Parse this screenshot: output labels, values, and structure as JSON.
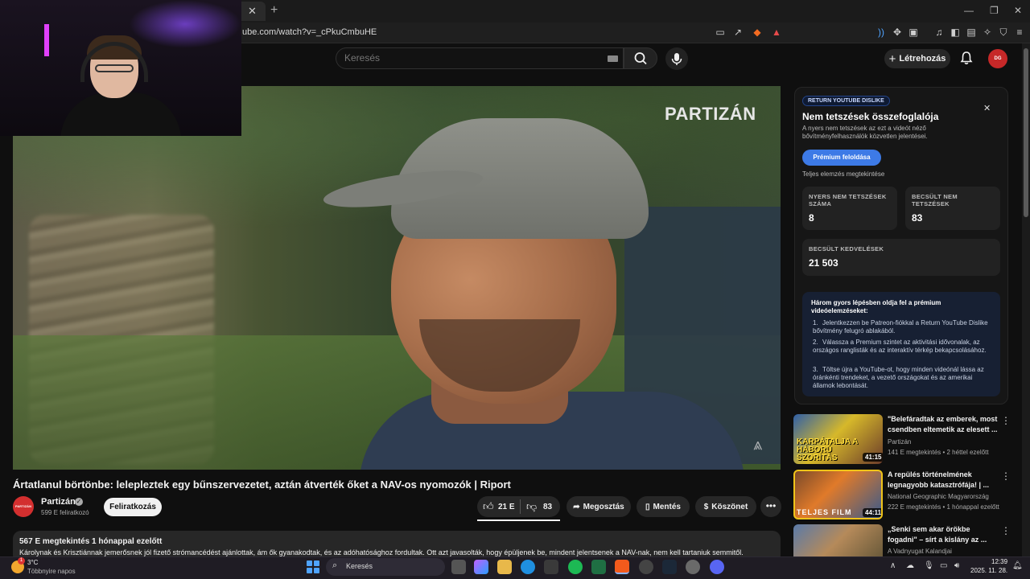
{
  "browser": {
    "url": "ube.com/watch?v=_cPkuCmbuHE"
  },
  "header": {
    "search_placeholder": "Keresés",
    "create_label": "Létrehozás",
    "avatar_text": "DG"
  },
  "video": {
    "watermark": "PARTIZÁN",
    "title": "Ártatlanul börtönbe: lelepleztek egy bűnszervezetet, aztán átverték őket a NAV-os nyomozók | Riport",
    "channel": "Partizán",
    "channel_logo_text": "PARTIZÁN",
    "subscribers": "599 E feliratkozó",
    "subscribe_label": "Feliratkozás",
    "likes": "21 E",
    "dislikes": "83",
    "share_label": "Megosztás",
    "save_label": "Mentés",
    "thanks_label": "Köszönet",
    "desc_meta": "567 E megtekintés  1 hónappal ezelőtt",
    "desc_text": "Károlynak és Krisztiánnak jemerősnek jól fizető strómancédést ajánlottak, ám ők gyanakodtak, és az adóhatósághoz fordultak. Ott azt javasolták, hogy épüljenek be, mindent jelentsenek a NAV-nak, nem kell tartaniuk semmitől."
  },
  "dislike_panel": {
    "tag": "RETURN YOUTUBE DISLIKE",
    "title": "Nem tetszések összefoglalója",
    "subtitle": "A nyers nem tetszések az ezt a videót néző bővítményfelhasználók közvetlen jelentései.",
    "premium_label": "Prémium feloldása",
    "full_analysis": "Teljes elemzés megtekintése",
    "raw_label": "NYERS NEM TETSZÉSEK SZÁMA",
    "raw_value": "8",
    "est_dislikes_label": "BECSÜLT NEM TETSZÉSEK",
    "est_dislikes_value": "83",
    "est_likes_label": "BECSÜLT KEDVELÉSEK",
    "est_likes_value": "21 503",
    "steps_title": "Három gyors lépésben oldja fel a prémium videóelemzéseket:",
    "steps": [
      "Jelentkezzen be Patreon-fiókkal a Return YouTube Dislike bővítmény felugró ablakából.",
      "Válassza a Premium szintet az aktivitási idővonalak, az országos ranglisták és az interaktív térkép bekapcsolásához.",
      "Töltse újra a YouTube-ot, hogy minden videónál lássa az óránkénti trendeket, a vezető országokat és az amerikai államok lebontását."
    ]
  },
  "recommendations": [
    {
      "title": "\"Belefáradtak az emberek, most csendben eltemetik az elesett ...",
      "channel": "Partizán",
      "meta": "141 E megtekintés • 2 héttel ezelőtt",
      "duration": "41:15",
      "overlay": "KARPÁTALJA A HÁBORÚ SZORÍTÁS"
    },
    {
      "title": "A repülés történelmének legnagyobb katasztrófája! | ...",
      "channel": "National Geographic Magyarország",
      "meta": "222 E megtekintés • 1 hónappal ezelőtt",
      "duration": "44:11",
      "overlay": "TELJES FILM"
    },
    {
      "title": "„Senki sem akar örökbe fogadni\" – sírt a kislány az ...",
      "channel": "A Vadnyugat Kalandjai",
      "meta": "",
      "duration": "",
      "overlay": ""
    }
  ],
  "taskbar": {
    "temp": "3°C",
    "weather_desc": "Többnyire napos",
    "weather_badge": "1",
    "search": "Keresés",
    "time": "12:39",
    "date": "2025. 11. 28."
  }
}
